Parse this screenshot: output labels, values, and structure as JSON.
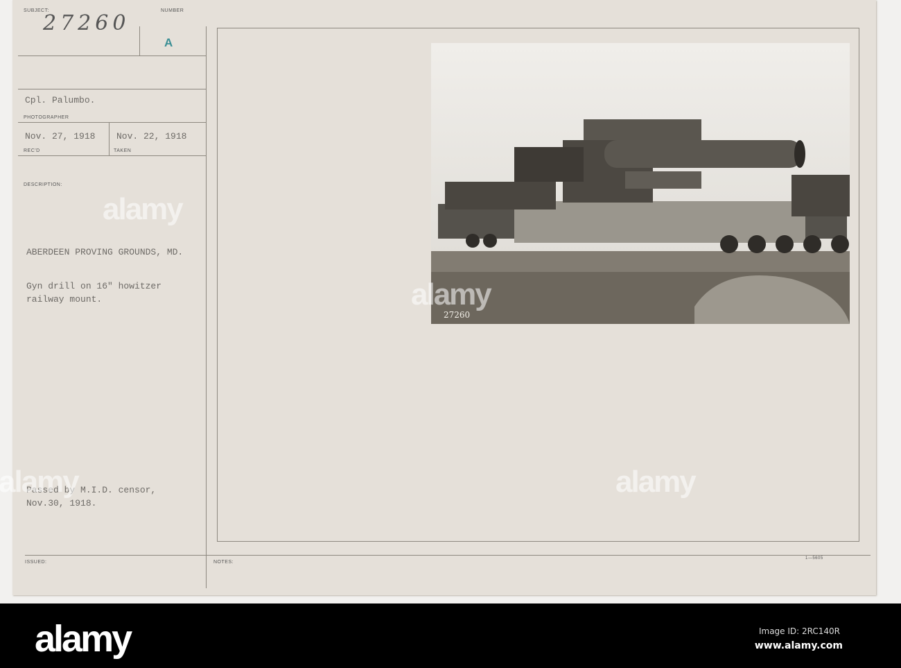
{
  "card": {
    "subject_label": "SUBJECT:",
    "subject_number": "27260",
    "number_label": "NUMBER",
    "number_value": "A",
    "photographer": "Cpl. Palumbo.",
    "photographer_label": "PHOTOGRAPHER",
    "received_date": "Nov. 27, 1918",
    "received_label": "REC'D",
    "taken_date": "Nov. 22, 1918",
    "taken_label": "TAKEN",
    "description_label": "DESCRIPTION:",
    "location": "ABERDEEN PROVING GROUNDS, MD.",
    "description_line1": "Gyn drill on 16\" howitzer",
    "description_line2": "railway mount.",
    "censor_line1": "Passed by M.I.D. censor,",
    "censor_line2": "Nov.30, 1918.",
    "issued_label": "ISSUED:",
    "notes_label": "NOTES:",
    "form_number": "1—5605",
    "photo_number": "27260",
    "number_color": "#3b8f95"
  },
  "watermark": {
    "logo": "alamy",
    "image_id": "Image ID: 2RC140R",
    "url": "www.alamy.com"
  }
}
